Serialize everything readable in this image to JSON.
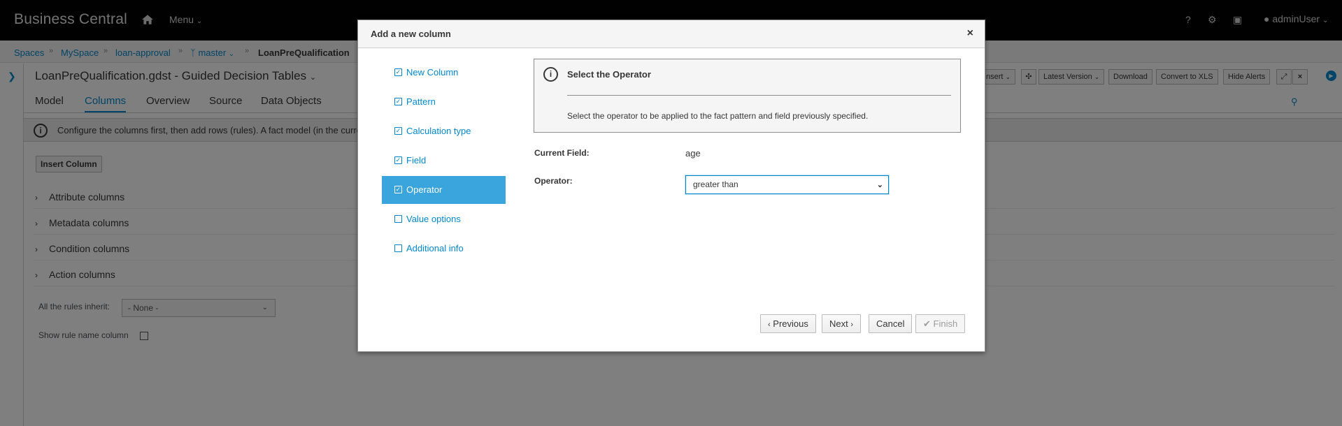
{
  "app": {
    "brand": "Business Central",
    "menu_label": "Menu",
    "user": "adminUser"
  },
  "breadcrumb": [
    {
      "label": "Spaces"
    },
    {
      "label": "MySpace"
    },
    {
      "label": "loan-approval"
    },
    {
      "label": "master"
    },
    {
      "label": "LoanPreQualification"
    }
  ],
  "editor": {
    "title": "LoanPreQualification.gdst - Guided Decision Tables",
    "tabs": [
      "Model",
      "Columns",
      "Overview",
      "Source",
      "Data Objects"
    ],
    "active_tab": "Columns",
    "info_text": "Configure the columns first, then add rows (rules). A fact model (in the curren",
    "insert_column_label": "Insert Column",
    "sections": [
      "Attribute columns",
      "Metadata columns",
      "Condition columns",
      "Action columns"
    ],
    "inherit_label": "All the rules inherit:",
    "inherit_value": "- None -",
    "show_rule_label": "Show rule name column",
    "toolbar": [
      "nsert",
      "Latest Version",
      "Download",
      "Convert to XLS",
      "Hide Alerts"
    ]
  },
  "modal": {
    "title": "Add a new column",
    "close": "×",
    "steps": [
      {
        "label": "New Column",
        "done": true
      },
      {
        "label": "Pattern",
        "done": true
      },
      {
        "label": "Calculation type",
        "done": true
      },
      {
        "label": "Field",
        "done": true
      },
      {
        "label": "Operator",
        "done": true,
        "active": true
      },
      {
        "label": "Value options",
        "done": false
      },
      {
        "label": "Additional info",
        "done": false
      }
    ],
    "alert": {
      "title": "Select the Operator",
      "text": "Select the operator to be applied to the fact pattern and field previously specified."
    },
    "current_field_label": "Current Field:",
    "current_field_value": "age",
    "operator_label": "Operator:",
    "operator_value": "greater than",
    "buttons": {
      "previous": "Previous",
      "next": "Next",
      "cancel": "Cancel",
      "finish": "Finish"
    }
  },
  "colors": {
    "navbar": "#030303",
    "accent": "#0088ce",
    "active_step": "#39a5dc"
  }
}
